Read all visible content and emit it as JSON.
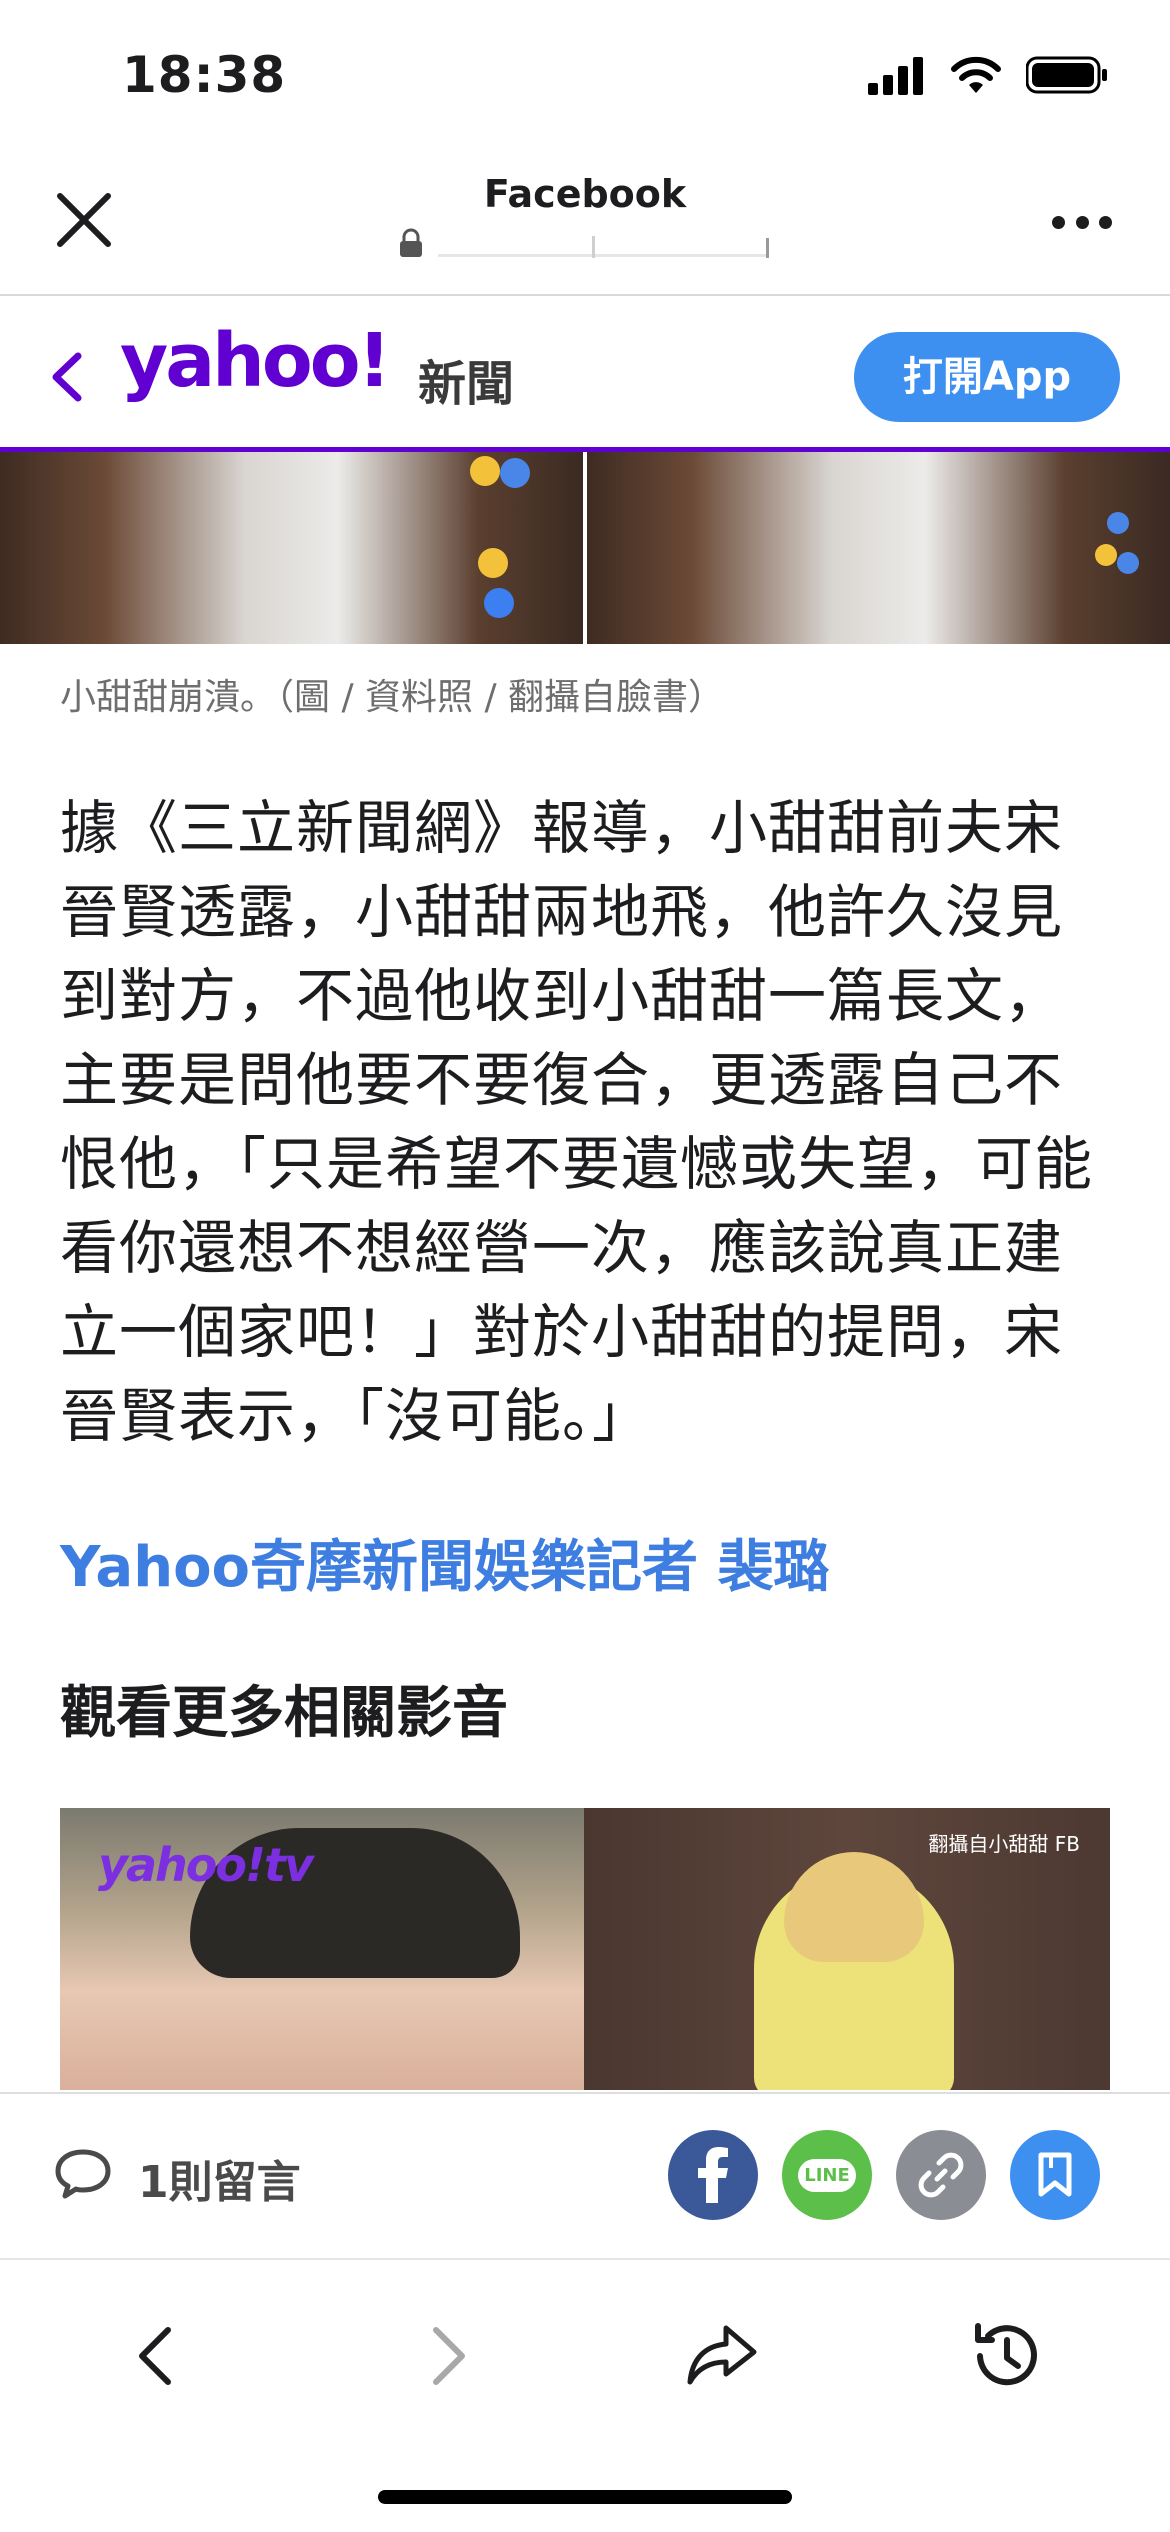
{
  "status_bar": {
    "time": "18:38"
  },
  "browser": {
    "title": "Facebook"
  },
  "header": {
    "logo_text": "yahoo!",
    "section_label": "新聞",
    "open_app_label": "打開App"
  },
  "article": {
    "caption": "小甜甜崩潰。（圖 / 資料照 / 翻攝自臉書）",
    "body": "據《三立新聞網》報導，小甜甜前夫宋晉賢透露，小甜甜兩地飛，他許久沒見到對方，不過他收到小甜甜一篇長文，主要是問他要不要復合，更透露自己不恨他，「只是希望不要遺憾或失望，可能看你還想不想經營一次，應該說真正建立一個家吧！」對於小甜甜的提問，宋晉賢表示，「沒可能。」",
    "byline": "Yahoo奇摩新聞娛樂記者 裴璐",
    "related_title": "觀看更多相關影音",
    "video_logo": "yahoo!tv",
    "video_credit": "翻攝自小甜甜 FB"
  },
  "action_bar": {
    "comment_count": "1則留言",
    "line_label": "LINE"
  },
  "colors": {
    "yahoo_purple": "#6001d2",
    "accent_blue": "#3d8ff0",
    "byline_blue": "#3e7ee0",
    "facebook_blue": "#3b5998",
    "line_green": "#5cbf4a"
  },
  "icons": {
    "close": "close-icon",
    "lock": "lock-icon",
    "more": "more-icon",
    "back": "chevron-left-icon",
    "comment": "comment-icon",
    "facebook": "facebook-icon",
    "line": "line-icon",
    "link": "link-icon",
    "bookmark": "bookmark-icon",
    "nav_back": "back-arrow-icon",
    "nav_forward": "forward-arrow-icon",
    "nav_share": "share-icon",
    "nav_history": "history-icon"
  }
}
